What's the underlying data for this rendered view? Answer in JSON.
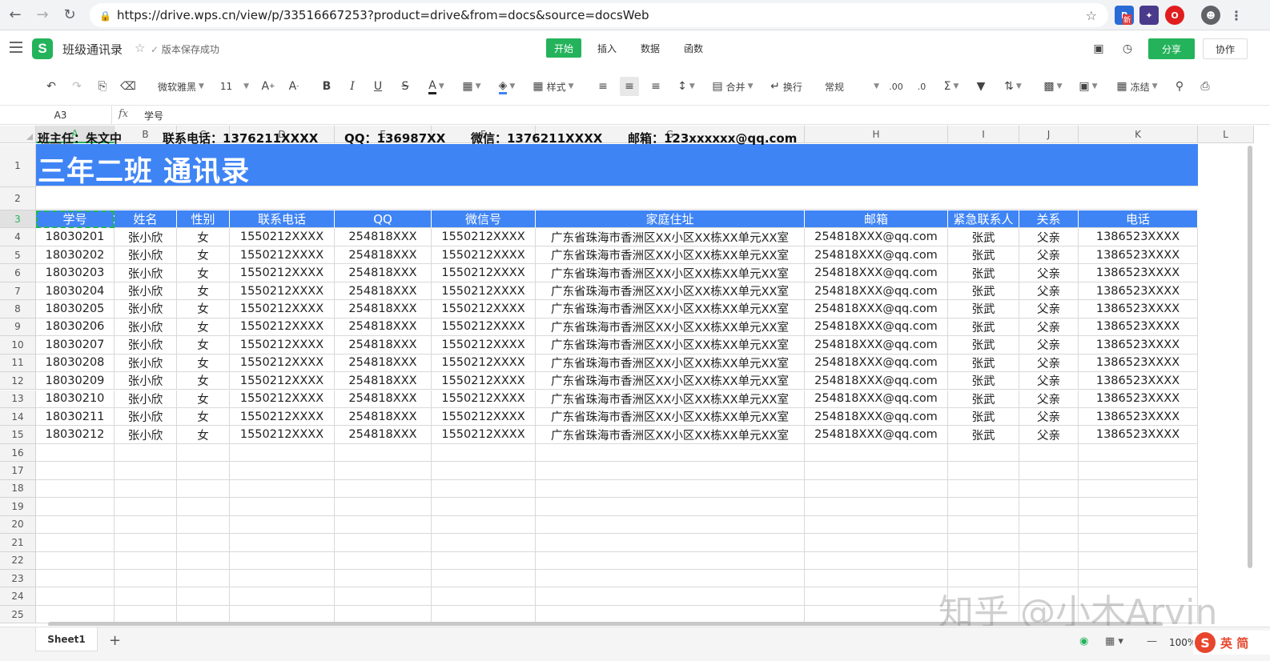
{
  "browser": {
    "url": "https://drive.wps.cn/view/p/33516667253?product=drive&from=docs&source=docsWeb",
    "ext_badge": "新"
  },
  "app": {
    "logo": "S",
    "doc_title": "班级通讯录",
    "save_status": "版本保存成功",
    "tabs": [
      "开始",
      "插入",
      "数据",
      "函数"
    ],
    "share_label": "分享",
    "collab_label": "协作"
  },
  "toolbar": {
    "font": "微软雅黑",
    "font_size": "11",
    "bold": "B",
    "italic": "I",
    "underline": "U",
    "strike": "S",
    "font_color": "A",
    "style_label": "样式",
    "merge_label": "合并",
    "wrap_label": "换行",
    "number_format": "常规",
    "freeze_label": "冻结"
  },
  "formula": {
    "name_box": "A3",
    "fx": "fx",
    "content": "学号"
  },
  "columns": [
    "A",
    "B",
    "C",
    "D",
    "E",
    "F",
    "G",
    "H",
    "I",
    "J",
    "K",
    "L"
  ],
  "rows": [
    "1",
    "2",
    "3",
    "4",
    "5",
    "6",
    "7",
    "8",
    "9",
    "10",
    "11",
    "12",
    "13",
    "14",
    "15",
    "16",
    "17",
    "18",
    "19",
    "20",
    "21",
    "22",
    "23",
    "24",
    "25"
  ],
  "sheet": {
    "title": "三年二班 通讯录",
    "info": {
      "teacher": "班主任：朱文中",
      "phone": "联系电话：1376211XXXX",
      "qq": "QQ：136987XX",
      "wechat": "微信：1376211XXXX",
      "email": "邮箱：123xxxxxx@qq.com"
    },
    "headers": [
      "学号",
      "姓名",
      "性别",
      "联系电话",
      "QQ",
      "微信号",
      "家庭住址",
      "邮箱",
      "紧急联系人",
      "关系",
      "电话"
    ],
    "records": [
      [
        "18030201",
        "张小欣",
        "女",
        "1550212XXXX",
        "254818XXX",
        "1550212XXXX",
        "广东省珠海市香洲区XX小区XX栋XX单元XX室",
        "254818XXX@qq.com",
        "张武",
        "父亲",
        "1386523XXXX"
      ],
      [
        "18030202",
        "张小欣",
        "女",
        "1550212XXXX",
        "254818XXX",
        "1550212XXXX",
        "广东省珠海市香洲区XX小区XX栋XX单元XX室",
        "254818XXX@qq.com",
        "张武",
        "父亲",
        "1386523XXXX"
      ],
      [
        "18030203",
        "张小欣",
        "女",
        "1550212XXXX",
        "254818XXX",
        "1550212XXXX",
        "广东省珠海市香洲区XX小区XX栋XX单元XX室",
        "254818XXX@qq.com",
        "张武",
        "父亲",
        "1386523XXXX"
      ],
      [
        "18030204",
        "张小欣",
        "女",
        "1550212XXXX",
        "254818XXX",
        "1550212XXXX",
        "广东省珠海市香洲区XX小区XX栋XX单元XX室",
        "254818XXX@qq.com",
        "张武",
        "父亲",
        "1386523XXXX"
      ],
      [
        "18030205",
        "张小欣",
        "女",
        "1550212XXXX",
        "254818XXX",
        "1550212XXXX",
        "广东省珠海市香洲区XX小区XX栋XX单元XX室",
        "254818XXX@qq.com",
        "张武",
        "父亲",
        "1386523XXXX"
      ],
      [
        "18030206",
        "张小欣",
        "女",
        "1550212XXXX",
        "254818XXX",
        "1550212XXXX",
        "广东省珠海市香洲区XX小区XX栋XX单元XX室",
        "254818XXX@qq.com",
        "张武",
        "父亲",
        "1386523XXXX"
      ],
      [
        "18030207",
        "张小欣",
        "女",
        "1550212XXXX",
        "254818XXX",
        "1550212XXXX",
        "广东省珠海市香洲区XX小区XX栋XX单元XX室",
        "254818XXX@qq.com",
        "张武",
        "父亲",
        "1386523XXXX"
      ],
      [
        "18030208",
        "张小欣",
        "女",
        "1550212XXXX",
        "254818XXX",
        "1550212XXXX",
        "广东省珠海市香洲区XX小区XX栋XX单元XX室",
        "254818XXX@qq.com",
        "张武",
        "父亲",
        "1386523XXXX"
      ],
      [
        "18030209",
        "张小欣",
        "女",
        "1550212XXXX",
        "254818XXX",
        "1550212XXXX",
        "广东省珠海市香洲区XX小区XX栋XX单元XX室",
        "254818XXX@qq.com",
        "张武",
        "父亲",
        "1386523XXXX"
      ],
      [
        "18030210",
        "张小欣",
        "女",
        "1550212XXXX",
        "254818XXX",
        "1550212XXXX",
        "广东省珠海市香洲区XX小区XX栋XX单元XX室",
        "254818XXX@qq.com",
        "张武",
        "父亲",
        "1386523XXXX"
      ],
      [
        "18030211",
        "张小欣",
        "女",
        "1550212XXXX",
        "254818XXX",
        "1550212XXXX",
        "广东省珠海市香洲区XX小区XX栋XX单元XX室",
        "254818XXX@qq.com",
        "张武",
        "父亲",
        "1386523XXXX"
      ],
      [
        "18030212",
        "张小欣",
        "女",
        "1550212XXXX",
        "254818XXX",
        "1550212XXXX",
        "广东省珠海市香洲区XX小区XX栋XX单元XX室",
        "254818XXX@qq.com",
        "张武",
        "父亲",
        "1386523XXXX"
      ]
    ]
  },
  "footer": {
    "sheet_tab": "Sheet1",
    "add_sheet": "+",
    "zoom": "100%",
    "ime_logo": "S",
    "ime_text": "英 简"
  },
  "watermark": "知乎 @小木Arvin",
  "colors": {
    "accent": "#24b35b",
    "header_blue": "#3f84f5"
  }
}
